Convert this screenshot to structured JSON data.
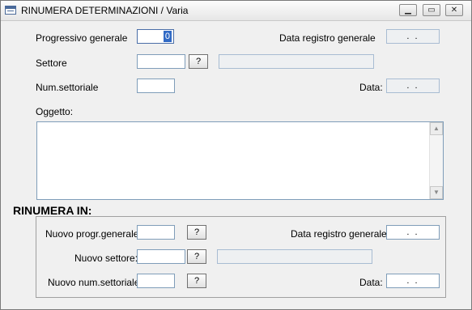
{
  "window": {
    "title": "RINUMERA DETERMINAZIONI / Varia",
    "controls": {
      "minimize": "▁",
      "maximize": "▭",
      "close": "✕"
    }
  },
  "form": {
    "progressivo_generale": {
      "label": "Progressivo generale",
      "value": "0"
    },
    "data_registro_generale": {
      "label": "Data registro generale",
      "value": ". ."
    },
    "settore": {
      "label": "Settore",
      "value": "",
      "lookup": "?",
      "description": ""
    },
    "num_settoriale": {
      "label": "Num.settoriale",
      "value": ""
    },
    "data": {
      "label": "Data:",
      "value": ". ."
    },
    "oggetto": {
      "label": "Oggetto:",
      "value": ""
    }
  },
  "rinumera": {
    "heading": "RINUMERA IN:",
    "nuovo_progr_generale": {
      "label": "Nuovo progr.generale:",
      "value": "",
      "lookup": "?"
    },
    "data_registro_generale": {
      "label": "Data registro generale:",
      "value": ". ."
    },
    "nuovo_settore": {
      "label": "Nuovo settore:",
      "value": "",
      "lookup": "?",
      "description": ""
    },
    "nuovo_num_settoriale": {
      "label": "Nuovo num.settoriale:",
      "value": "",
      "lookup": "?"
    },
    "data": {
      "label": "Data:",
      "value": ". ."
    }
  },
  "scrollbar": {
    "up": "▲",
    "down": "▼"
  }
}
